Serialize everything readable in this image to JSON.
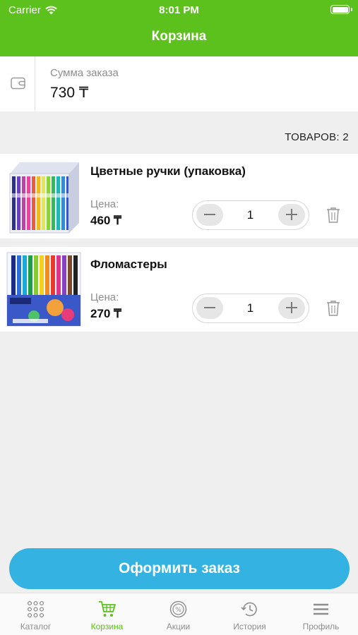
{
  "status_bar": {
    "carrier": "Carrier",
    "time": "8:01 PM"
  },
  "header": {
    "title": "Корзина"
  },
  "summary": {
    "label": "Сумма заказа",
    "value": "730 ₸"
  },
  "items_count": "ТОВАРОВ: 2",
  "products": [
    {
      "name": "Цветные ручки (упаковка)",
      "price_label": "Цена:",
      "price": "460 ₸",
      "quantity": "1"
    },
    {
      "name": "Фломастеры",
      "price_label": "Цена:",
      "price": "270 ₸",
      "quantity": "1"
    }
  ],
  "checkout_label": "Оформить заказ",
  "tabs": [
    {
      "label": "Каталог",
      "icon": "grid-icon",
      "active": false
    },
    {
      "label": "Корзина",
      "icon": "cart-icon",
      "active": true
    },
    {
      "label": "Акции",
      "icon": "percent-badge-icon",
      "active": false
    },
    {
      "label": "История",
      "icon": "history-icon",
      "active": false
    },
    {
      "label": "Профиль",
      "icon": "menu-icon",
      "active": false
    }
  ],
  "colors": {
    "brand_green": "#5cc11c",
    "checkout_blue": "#34b3e3",
    "background": "#efefef"
  }
}
